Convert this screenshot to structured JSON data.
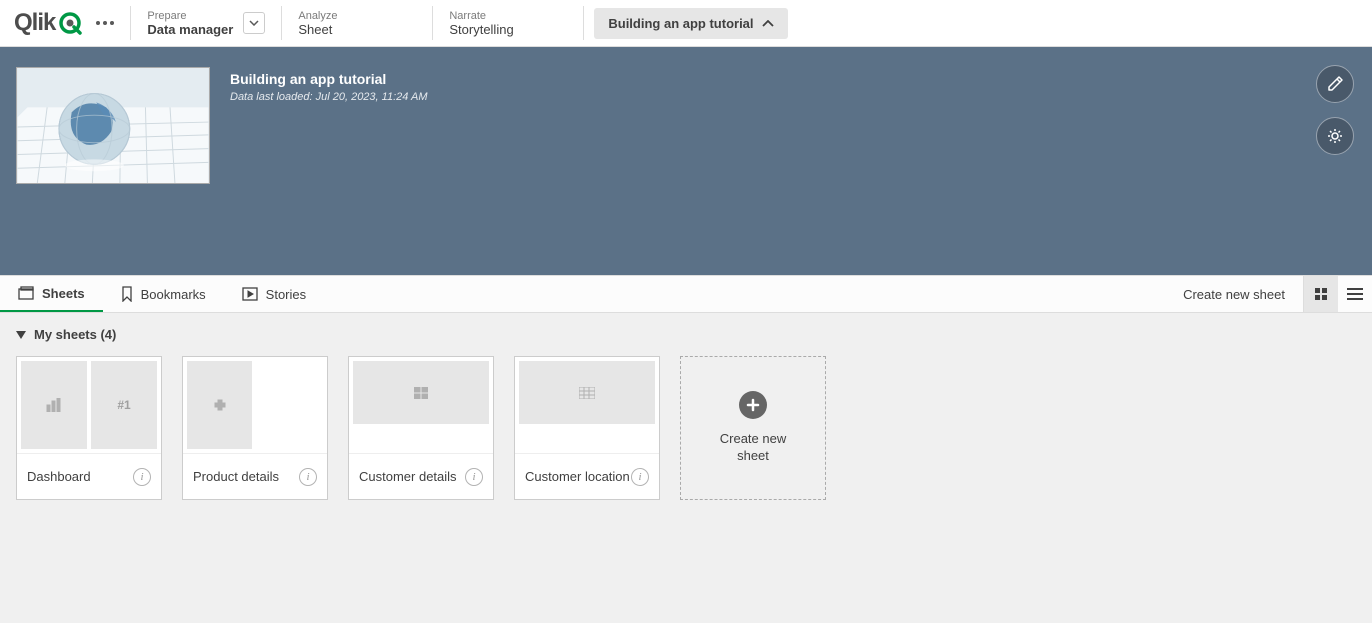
{
  "topbar": {
    "brand": "Qlik",
    "nav": [
      {
        "label": "Prepare",
        "value": "Data manager",
        "has_dropdown": true
      },
      {
        "label": "Analyze",
        "value": "Sheet",
        "has_dropdown": false
      },
      {
        "label": "Narrate",
        "value": "Storytelling",
        "has_dropdown": false
      }
    ],
    "app_pill": "Building an app tutorial"
  },
  "hero": {
    "title": "Building an app tutorial",
    "subtitle": "Data last loaded: Jul 20, 2023, 11:24 AM"
  },
  "tabs": {
    "items": [
      {
        "label": "Sheets",
        "active": true
      },
      {
        "label": "Bookmarks",
        "active": false
      },
      {
        "label": "Stories",
        "active": false
      }
    ],
    "create_label": "Create new sheet"
  },
  "section": {
    "heading": "My sheets (4)"
  },
  "sheets": [
    {
      "name": "Dashboard"
    },
    {
      "name": "Product details"
    },
    {
      "name": "Customer details"
    },
    {
      "name": "Customer location"
    }
  ],
  "new_card": {
    "label": "Create new sheet"
  },
  "icons": {
    "more": "more-icon",
    "chevron_down": "chevron-down-icon",
    "chevron_up": "chevron-up-icon",
    "edit": "pencil-icon",
    "settings": "gear-icon",
    "sheets": "sheets-icon",
    "bookmark": "bookmark-icon",
    "story": "play-story-icon",
    "grid": "grid-view-icon",
    "list": "list-view-icon",
    "collapse": "caret-down-icon",
    "info": "info-icon",
    "plus": "plus-icon"
  }
}
